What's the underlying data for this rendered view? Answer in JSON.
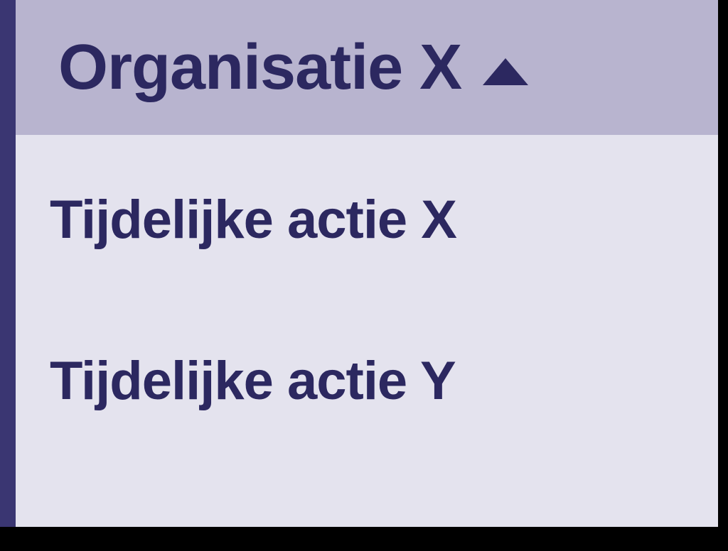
{
  "header": {
    "title": "Organisatie X"
  },
  "menu": {
    "items": [
      {
        "label": "Tijdelijke actie X"
      },
      {
        "label": "Tijdelijke actie Y"
      }
    ]
  }
}
